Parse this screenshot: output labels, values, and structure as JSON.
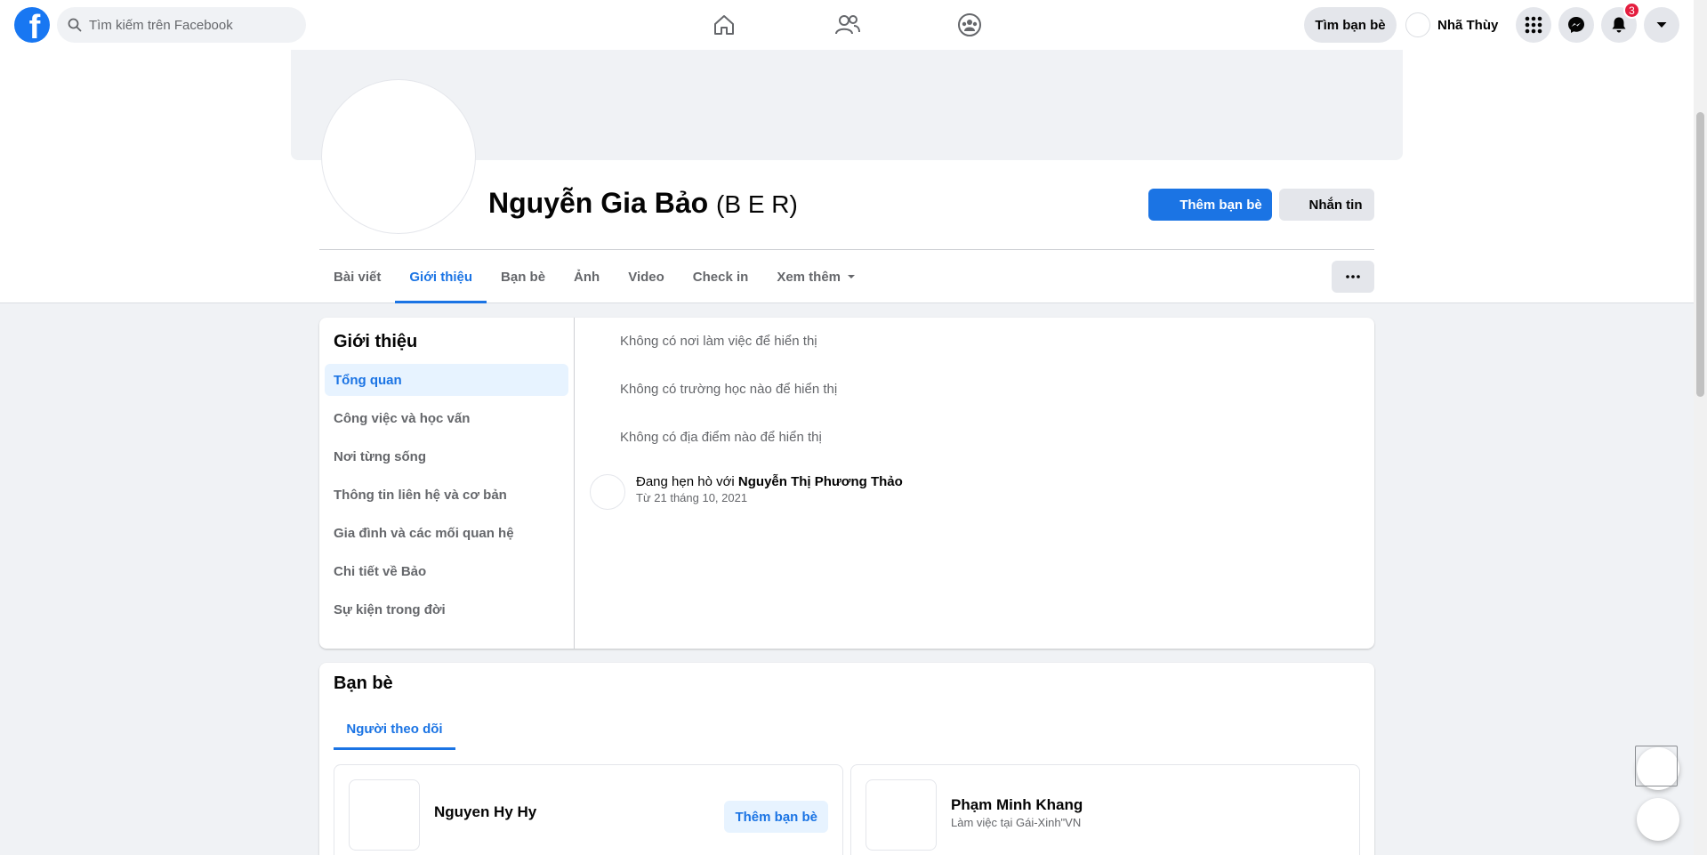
{
  "topbar": {
    "search_placeholder": "Tìm kiếm trên Facebook",
    "find_friends_label": "Tìm bạn bè",
    "user_name": "Nhã Thùy",
    "notification_count": "3",
    "icons": [
      "facebook-logo",
      "search-icon",
      "home-icon",
      "friends-icon",
      "groups-icon",
      "menu-grid-icon",
      "messenger-icon",
      "bell-icon",
      "account-caret-icon"
    ]
  },
  "profile": {
    "name": "Nguyễn Gia Bảo",
    "alt_name": "(B E R)",
    "add_friend_label": "Thêm bạn bè",
    "message_label": "Nhắn tin",
    "tabs": [
      {
        "label": "Bài viết"
      },
      {
        "label": "Giới thiệu"
      },
      {
        "label": "Bạn bè"
      },
      {
        "label": "Ảnh"
      },
      {
        "label": "Video"
      },
      {
        "label": "Check in"
      },
      {
        "label": "Xem thêm"
      }
    ],
    "active_tab": "Giới thiệu"
  },
  "about": {
    "title": "Giới thiệu",
    "menu": [
      {
        "label": "Tổng quan"
      },
      {
        "label": "Công việc và học vấn"
      },
      {
        "label": "Nơi từng sống"
      },
      {
        "label": "Thông tin liên hệ và cơ bản"
      },
      {
        "label": "Gia đình và các mối quan hệ"
      },
      {
        "label": "Chi tiết về Bảo"
      },
      {
        "label": "Sự kiện trong đời"
      }
    ],
    "work": "Không có nơi làm việc để hiển thị",
    "school": "Không có trường học nào để hiển thị",
    "place": "Không có địa điểm nào để hiển thị",
    "relationship_prefix": "Đang hẹn hò với ",
    "relationship_partner": "Nguyễn Thị Phương Thảo",
    "relationship_since": "Từ 21 tháng 10, 2021"
  },
  "friends": {
    "title": "Bạn bè",
    "tab_label": "Người theo dõi",
    "items": [
      {
        "name": "Nguyen Hy Hy",
        "subtitle": "",
        "button": "Thêm bạn bè"
      },
      {
        "name": "Phạm Minh Khang",
        "subtitle": "Làm việc tại Gái-Xinh\"VN",
        "button": ""
      }
    ]
  },
  "colors": {
    "brand": "#1877f2",
    "accent": "#1b74e4",
    "badge": "#e41e3f"
  }
}
